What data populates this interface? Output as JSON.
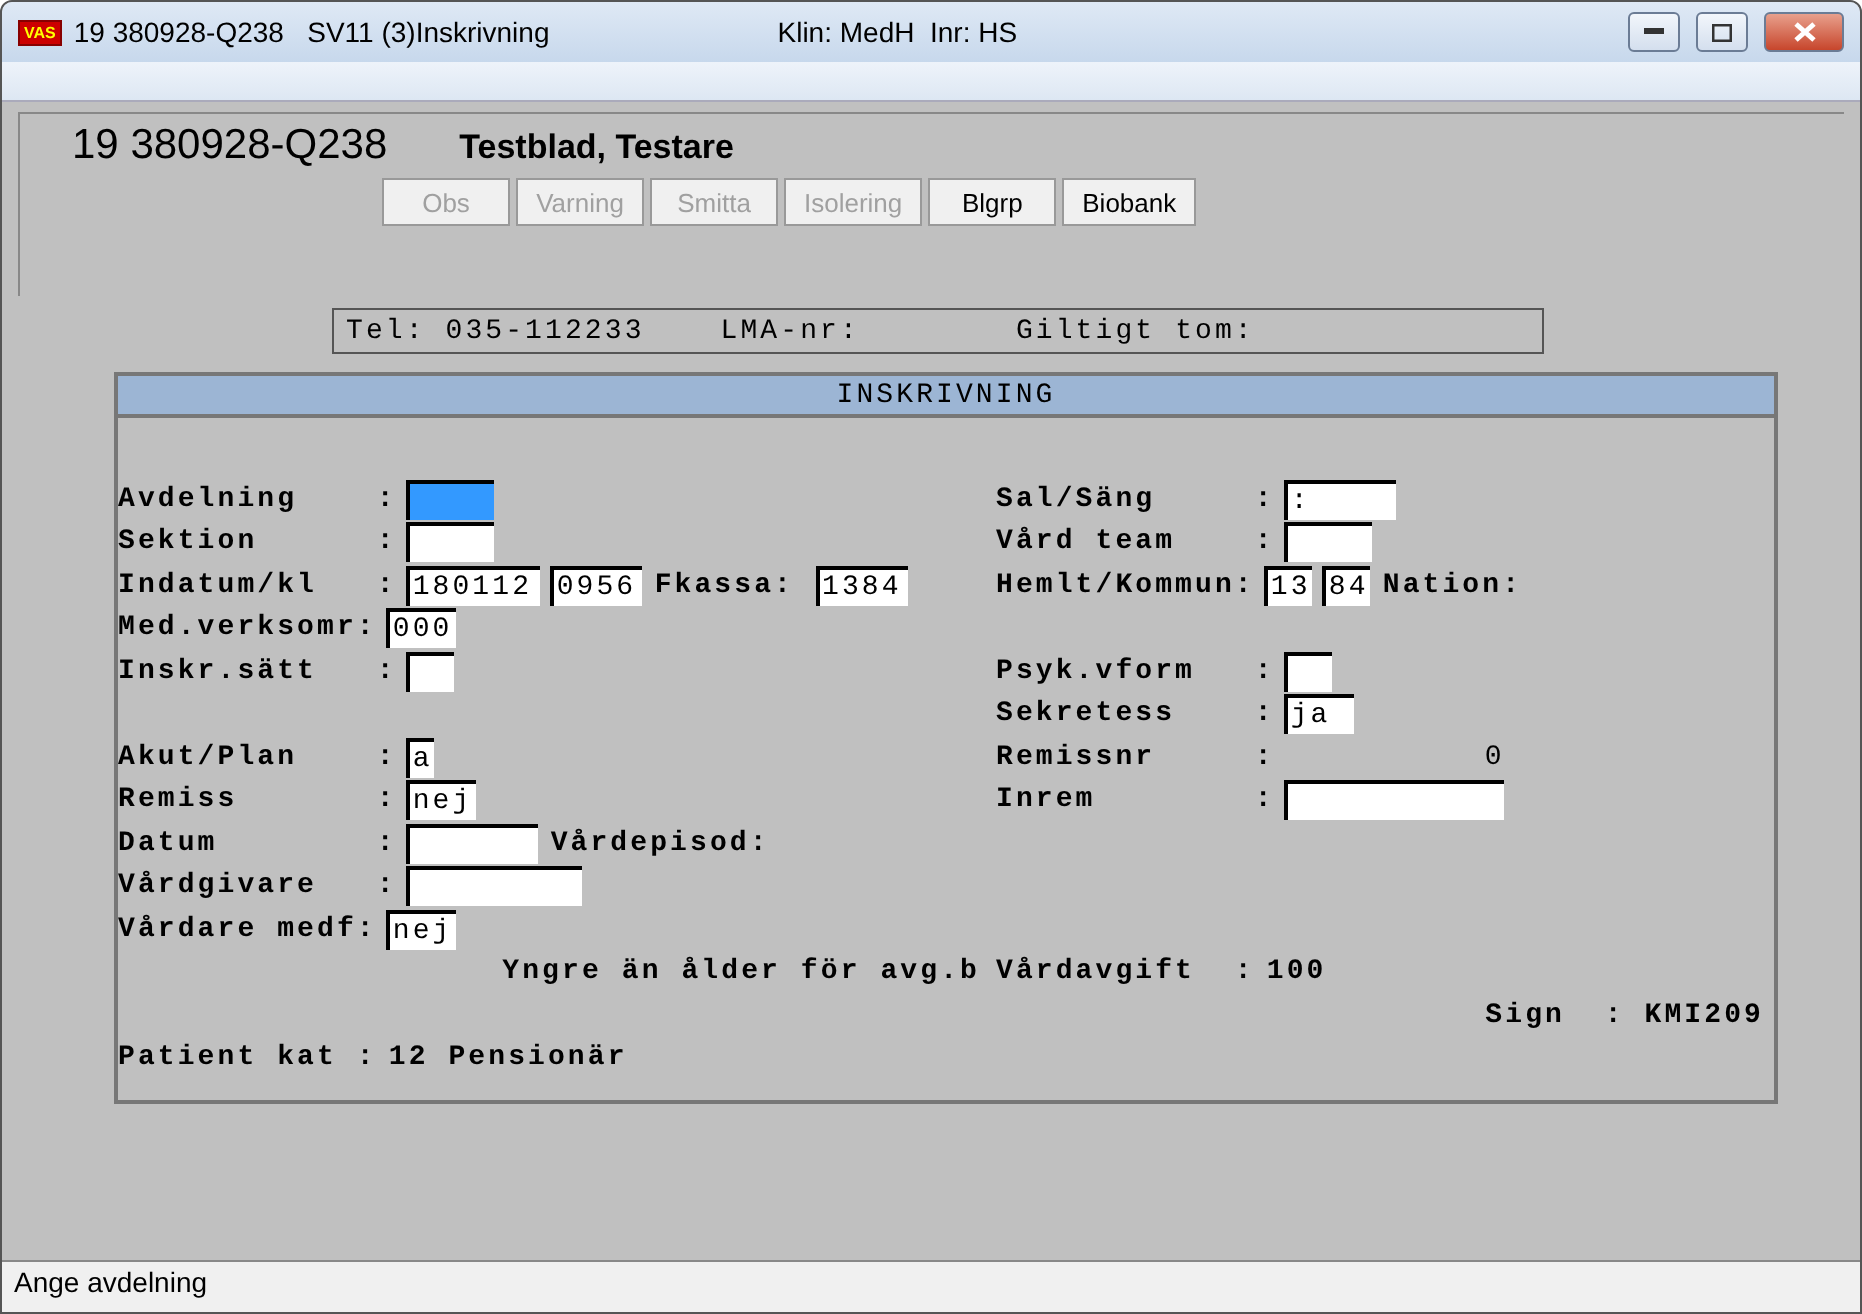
{
  "window": {
    "app_badge": "VAS",
    "title": "19 380928-Q238   SV11 (3)Inskrivning",
    "context": "Klin: MedH  Inr: HS"
  },
  "patient": {
    "id": "19 380928-Q238",
    "name": "Testblad, Testare"
  },
  "flags": [
    {
      "label": "Obs",
      "disabled": true
    },
    {
      "label": "Varning",
      "disabled": true
    },
    {
      "label": "Smitta",
      "disabled": true
    },
    {
      "label": "Isolering",
      "disabled": true
    },
    {
      "label": "Blgrp",
      "disabled": false
    },
    {
      "label": "Biobank",
      "disabled": false
    }
  ],
  "contact": {
    "phone": "Tel: 035-112233",
    "lma": "LMA-nr:",
    "valid": "Giltigt tom:"
  },
  "section": {
    "title": "INSKRIVNING",
    "rows": [
      {
        "left": {
          "kind": "form",
          "label": "Avdelning    :",
          "items": [
            {
              "kind": "field",
              "value": "",
              "focused": true
            }
          ]
        },
        "right": {
          "kind": "form",
          "label": "Sal/Säng     :",
          "items": [
            {
              "kind": "field",
              "value": ":",
              "focused": false
            }
          ]
        }
      },
      {
        "left": {
          "kind": "form",
          "label": "Sektion      :",
          "items": [
            {
              "kind": "field",
              "value": "",
              "focused": false
            }
          ]
        },
        "right": {
          "kind": "form",
          "label": "Vård team    :",
          "items": [
            {
              "kind": "field",
              "value": "",
              "focused": false
            }
          ]
        }
      },
      {
        "left": {
          "kind": "form",
          "label": "Indatum/kl   :",
          "items": [
            {
              "kind": "field",
              "value": "180112",
              "focused": false
            },
            {
              "kind": "field",
              "value": "0956",
              "focused": false
            },
            {
              "kind": "text",
              "text": "Fkassa:"
            },
            {
              "kind": "field",
              "value": "1384",
              "focused": false
            }
          ]
        },
        "right": {
          "kind": "form",
          "label": "Hemlt/Kommun:",
          "items": [
            {
              "kind": "field",
              "value": "13",
              "focused": false
            },
            {
              "kind": "field",
              "value": "84",
              "focused": false
            },
            {
              "kind": "text",
              "text": "Nation:"
            }
          ]
        }
      },
      {
        "left": {
          "kind": "form",
          "label": "Med.verksomr:",
          "items": [
            {
              "kind": "field",
              "value": "000",
              "focused": false
            }
          ]
        }
      },
      {
        "left": {
          "kind": "form",
          "label": "Inskr.sätt   :",
          "items": [
            {
              "kind": "field",
              "value": "",
              "focused": false
            }
          ]
        },
        "right": {
          "kind": "form",
          "label": "Psyk.vform   :",
          "items": [
            {
              "kind": "field",
              "value": "",
              "focused": false
            }
          ]
        }
      },
      {
        "right": {
          "kind": "form",
          "label": "Sekretess    :",
          "items": [
            {
              "kind": "field",
              "value": "ja",
              "focused": false
            }
          ]
        }
      },
      {
        "left": {
          "kind": "form",
          "label": "Akut/Plan    :",
          "items": [
            {
              "kind": "field",
              "value": "a",
              "focused": false
            }
          ]
        },
        "right": {
          "kind": "form",
          "label": "Remissnr     :",
          "items": [
            {
              "kind": "number",
              "value": "0"
            }
          ]
        }
      },
      {
        "left": {
          "kind": "form",
          "label": "Remiss       :",
          "items": [
            {
              "kind": "field",
              "value": "nej",
              "focused": false
            }
          ]
        },
        "right": {
          "kind": "form",
          "label": "Inrem        :",
          "items": [
            {
              "kind": "field",
              "value": "",
              "focused": false
            }
          ]
        }
      },
      {
        "left": {
          "kind": "form",
          "label": "Datum        :",
          "items": [
            {
              "kind": "field",
              "value": "",
              "focused": false
            },
            {
              "kind": "text",
              "text": "Vårdepisod:"
            }
          ]
        }
      },
      {
        "left": {
          "kind": "form",
          "label": "Vårdgivare   :",
          "items": [
            {
              "kind": "field",
              "value": "",
              "focused": false
            }
          ]
        }
      },
      {
        "left": {
          "kind": "form",
          "label": "Vårdare medf:",
          "items": [
            {
              "kind": "field",
              "value": "nej",
              "focused": false
            }
          ]
        }
      },
      {
        "left": {
          "kind": "note",
          "text": "Yngre än ålder för avg.b"
        },
        "right": {
          "kind": "form",
          "label": "Vårdavgift  :",
          "items": [
            {
              "kind": "text",
              "text": "100"
            }
          ]
        }
      },
      {
        "right": {
          "kind": "note",
          "text": "Sign  : KMI209"
        }
      },
      {
        "left": {
          "kind": "form",
          "label": "Patient kat :",
          "items": [
            {
              "kind": "text",
              "text": "12 Pensionär"
            }
          ]
        }
      }
    ]
  },
  "status_bar": {
    "text": "Ange avdelning"
  }
}
